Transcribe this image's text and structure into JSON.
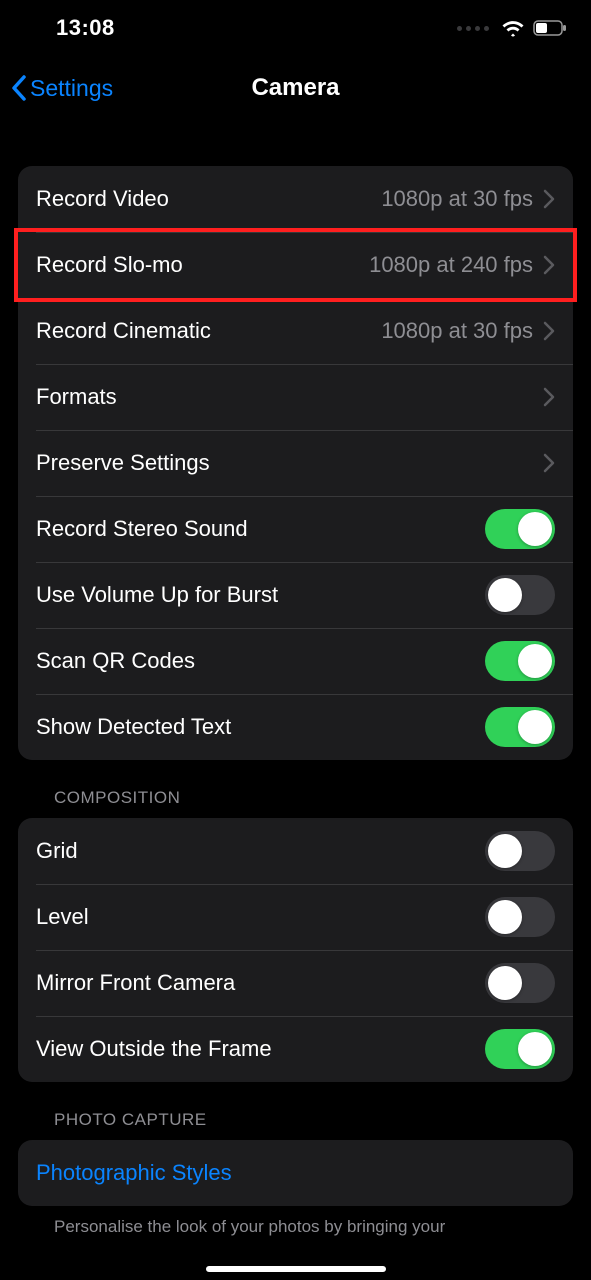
{
  "status": {
    "time": "13:08"
  },
  "nav": {
    "back_label": "Settings",
    "title": "Camera"
  },
  "section1": {
    "rows": [
      {
        "label": "Record Video",
        "value": "1080p at 30 fps",
        "disclosure": true
      },
      {
        "label": "Record Slo-mo",
        "value": "1080p at 240 fps",
        "disclosure": true,
        "highlighted": true
      },
      {
        "label": "Record Cinematic",
        "value": "1080p at 30 fps",
        "disclosure": true
      },
      {
        "label": "Formats",
        "value": "",
        "disclosure": true
      },
      {
        "label": "Preserve Settings",
        "value": "",
        "disclosure": true
      },
      {
        "label": "Record Stereo Sound",
        "toggle": true,
        "on": true
      },
      {
        "label": "Use Volume Up for Burst",
        "toggle": true,
        "on": false
      },
      {
        "label": "Scan QR Codes",
        "toggle": true,
        "on": true
      },
      {
        "label": "Show Detected Text",
        "toggle": true,
        "on": true
      }
    ]
  },
  "section2": {
    "header": "COMPOSITION",
    "rows": [
      {
        "label": "Grid",
        "toggle": true,
        "on": false
      },
      {
        "label": "Level",
        "toggle": true,
        "on": false
      },
      {
        "label": "Mirror Front Camera",
        "toggle": true,
        "on": false
      },
      {
        "label": "View Outside the Frame",
        "toggle": true,
        "on": true
      }
    ]
  },
  "section3": {
    "header": "PHOTO CAPTURE",
    "rows": [
      {
        "label": "Photographic Styles",
        "link": true,
        "disclosure": false
      }
    ],
    "footer": "Personalise the look of your photos by bringing your"
  }
}
